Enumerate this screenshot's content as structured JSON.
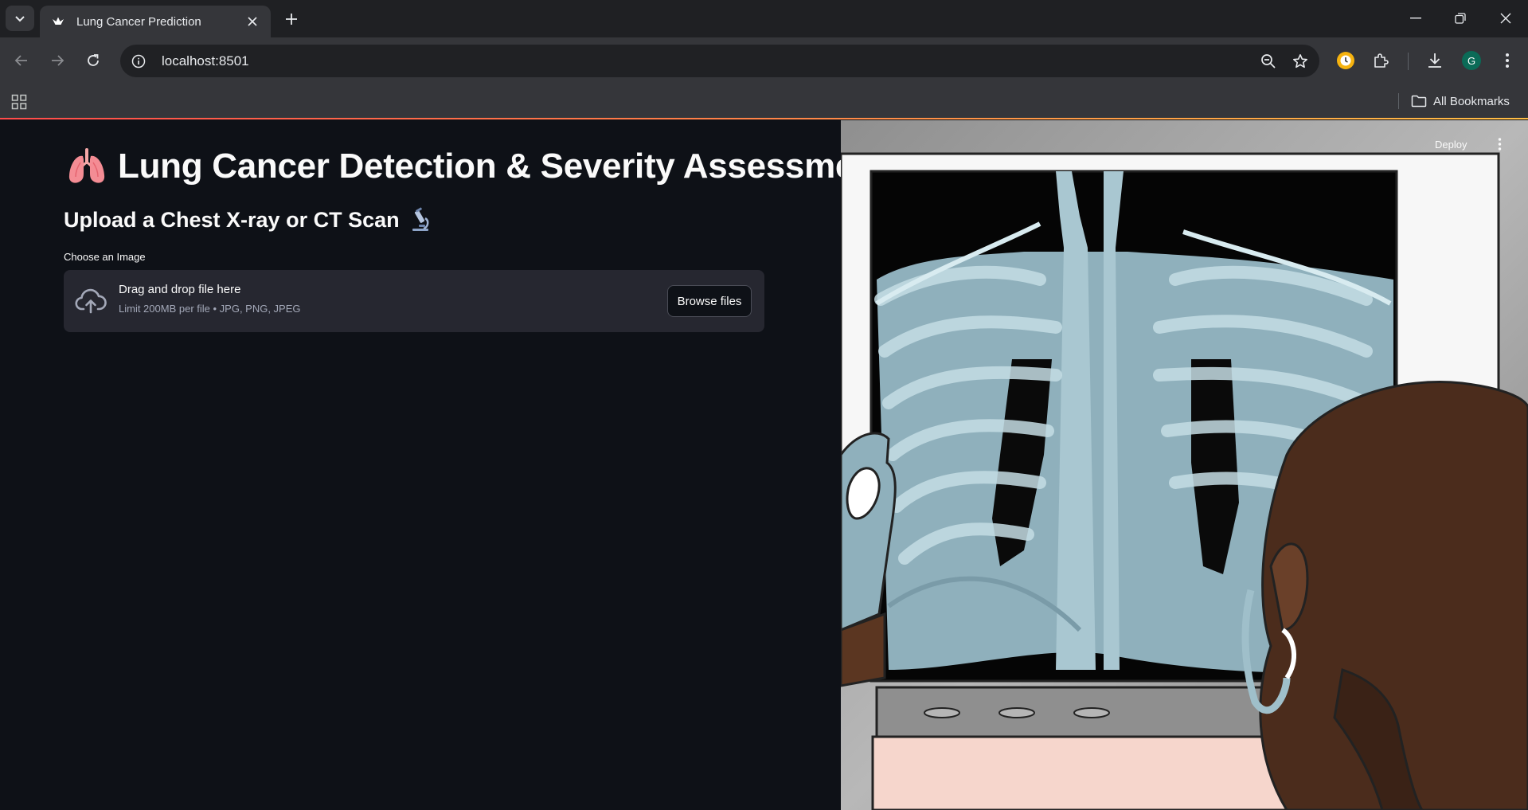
{
  "browser": {
    "tab_title": "Lung Cancer Prediction",
    "url": "localhost:8501",
    "all_bookmarks_label": "All Bookmarks",
    "profile_initial": "G",
    "profile_color": "#0b6b57",
    "icons": {
      "tab_search": "chevron-down-icon",
      "favicon": "streamlit-crown-icon",
      "close_tab": "close-icon",
      "new_tab": "plus-icon",
      "back": "arrow-left-icon",
      "forward": "arrow-right-icon",
      "reload": "reload-icon",
      "site_info": "site-info-icon",
      "zoom": "zoom-out-icon",
      "bookmark_star": "star-icon",
      "extension": "puzzle-icon",
      "download": "download-icon",
      "menu": "kebab-menu-icon",
      "apps": "apps-grid-icon",
      "folder": "folder-icon"
    }
  },
  "app": {
    "title": "Lung Cancer Detection & Severity Assessment",
    "title_emoji": "lungs",
    "subheader": "Upload a Chest X-ray or CT Scan",
    "subheader_emoji": "microscope",
    "uploader": {
      "label": "Choose an Image",
      "drag_text": "Drag and drop file here",
      "limit_text": "Limit 200MB per file • JPG, PNG, JPEG",
      "browse_label": "Browse files"
    },
    "header_actions": {
      "deploy_label": "Deploy"
    }
  },
  "colors": {
    "app_background": "#0e1117",
    "dropzone_background": "#262730",
    "accent_gradient_start": "#ff4b4b",
    "accent_gradient_end": "#ffbd45",
    "text_primary": "#fafafa",
    "text_secondary": "#a3a8b8"
  }
}
